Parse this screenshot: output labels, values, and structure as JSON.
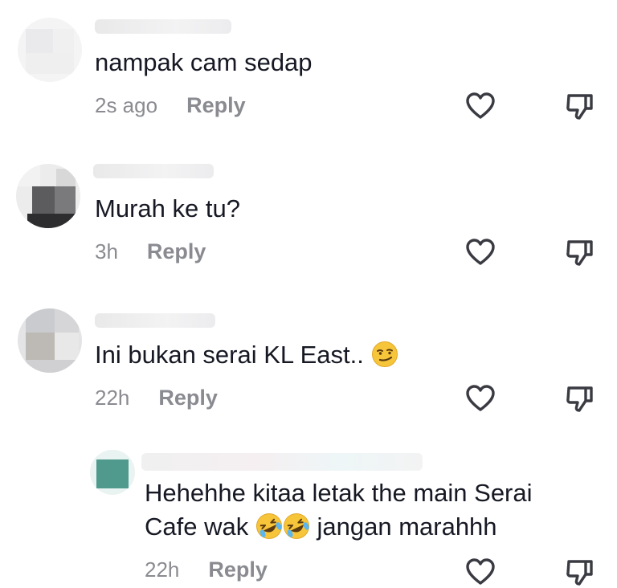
{
  "comments": [
    {
      "text": "nampak cam sedap",
      "time": "2s ago",
      "reply": "Reply"
    },
    {
      "text": "Murah ke tu?",
      "time": "3h",
      "reply": "Reply"
    },
    {
      "text": "Ini bukan serai KL East..",
      "time": "22h",
      "reply": "Reply",
      "emoji": "smirking-face-emoji"
    },
    {
      "text_line1": "Hehehhe kitaa letak the main Serai",
      "text_line2_a": "Cafe wak",
      "text_line2_b": "jangan marahhh",
      "time": "22h",
      "reply": "Reply",
      "emoji": "rolling-on-floor-laughing-emoji"
    }
  ],
  "icons": {
    "like": "heart-outline-icon",
    "dislike": "thumbs-down-outline-icon"
  },
  "colors": {
    "text": "#161823",
    "meta": "#8a8b91",
    "icon": "#3a3b42"
  }
}
